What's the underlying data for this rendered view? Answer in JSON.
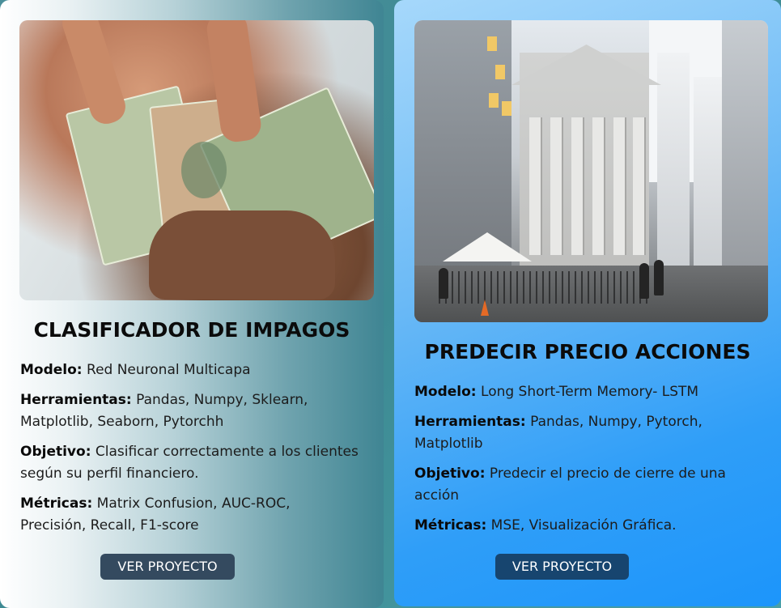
{
  "cards": [
    {
      "title": "CLASIFICADOR DE IMPAGOS",
      "image_alt": "money-in-hand-photo",
      "fields": [
        {
          "label": "Modelo:",
          "value": "Red Neuronal Multicapa"
        },
        {
          "label": "Herramientas:",
          "value": "Pandas, Numpy, Sklearn, Matplotlib, Seaborn, Pytorchh"
        },
        {
          "label": "Objetivo:",
          "value": "Clasificar correctamente a los clientes según su perfil financiero."
        },
        {
          "label": "Métricas:",
          "value": "Matrix Confusion, AUC-ROC, Precisión, Recall, F1-score"
        }
      ],
      "button_label": "VER PROYECTO"
    },
    {
      "title": "PREDECIR PRECIO ACCIONES",
      "image_alt": "stock-exchange-photo",
      "fields": [
        {
          "label": "Modelo:",
          "value": "Long Short-Term Memory- LSTM"
        },
        {
          "label": "Herramientas:",
          "value": "Pandas, Numpy, Pytorch, Matplotlib"
        },
        {
          "label": "Objetivo:",
          "value": "Predecir el precio de cierre de una acción"
        },
        {
          "label": "Métricas:",
          "value": "MSE, Visualización Gráfica."
        }
      ],
      "button_label": "VER PROYECTO"
    }
  ],
  "colors": {
    "left_button": "#344a5f",
    "right_button": "#17456f",
    "right_card_accent": "#1c95fb"
  }
}
